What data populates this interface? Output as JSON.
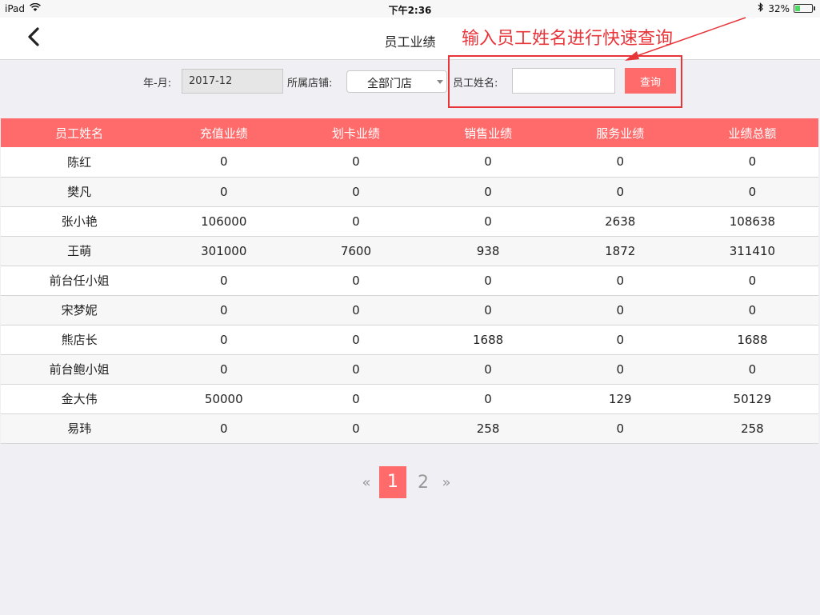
{
  "status_bar": {
    "device": "iPad",
    "time": "下午2:36",
    "battery": "32%",
    "battery_level": 0.32
  },
  "nav": {
    "title": "员工业绩"
  },
  "annotation": {
    "text": "输入员工姓名进行快速查询"
  },
  "filter": {
    "date_label": "年-月:",
    "date_value": "2017-12",
    "store_label": "所属店铺:",
    "store_value": "全部门店",
    "name_label": "员工姓名:",
    "name_value": "",
    "query_label": "查询"
  },
  "table": {
    "headers": [
      "员工姓名",
      "充值业绩",
      "划卡业绩",
      "销售业绩",
      "服务业绩",
      "业绩总额"
    ],
    "rows": [
      [
        "陈红",
        "0",
        "0",
        "0",
        "0",
        "0"
      ],
      [
        "樊凡",
        "0",
        "0",
        "0",
        "0",
        "0"
      ],
      [
        "张小艳",
        "106000",
        "0",
        "0",
        "2638",
        "108638"
      ],
      [
        "王萌",
        "301000",
        "7600",
        "938",
        "1872",
        "311410"
      ],
      [
        "前台任小姐",
        "0",
        "0",
        "0",
        "0",
        "0"
      ],
      [
        "宋梦妮",
        "0",
        "0",
        "0",
        "0",
        "0"
      ],
      [
        "熊店长",
        "0",
        "0",
        "1688",
        "0",
        "1688"
      ],
      [
        "前台鲍小姐",
        "0",
        "0",
        "0",
        "0",
        "0"
      ],
      [
        "金大伟",
        "50000",
        "0",
        "0",
        "129",
        "50129"
      ],
      [
        "易玮",
        "0",
        "0",
        "258",
        "0",
        "258"
      ]
    ]
  },
  "pagination": {
    "prev": "«",
    "pages": [
      "1",
      "2"
    ],
    "current": "1",
    "next": "»"
  },
  "colors": {
    "accent": "#ff6b6b",
    "annotation": "#e8353a",
    "battery": "#4cd964"
  },
  "icons": {
    "back": "chevron-left-icon",
    "wifi": "wifi-icon",
    "bluetooth": "bluetooth-icon",
    "battery": "battery-icon",
    "dropdown": "caret-down-icon"
  }
}
